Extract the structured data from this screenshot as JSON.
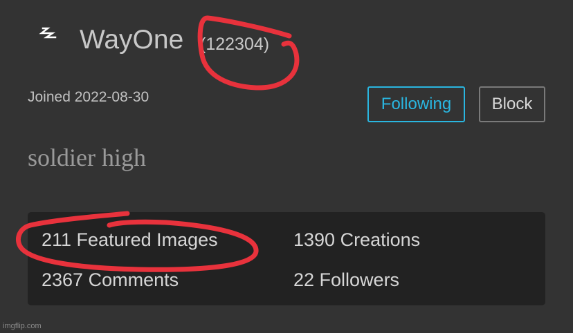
{
  "profile": {
    "username": "WayOne",
    "points": "(122304)",
    "joined": "Joined 2022-08-30",
    "bio": "soldier high"
  },
  "actions": {
    "following_label": "Following",
    "block_label": "Block"
  },
  "stats": {
    "featured": "211 Featured Images",
    "creations": "1390 Creations",
    "comments": "2367 Comments",
    "followers": "22 Followers"
  },
  "watermark": "imgflip.com",
  "icons": {
    "avatar": "lightning-bolt-icon"
  },
  "colors": {
    "background": "#333333",
    "accent": "#2ab6e0",
    "stats_panel": "#222222",
    "annotation": "#e8323c"
  }
}
